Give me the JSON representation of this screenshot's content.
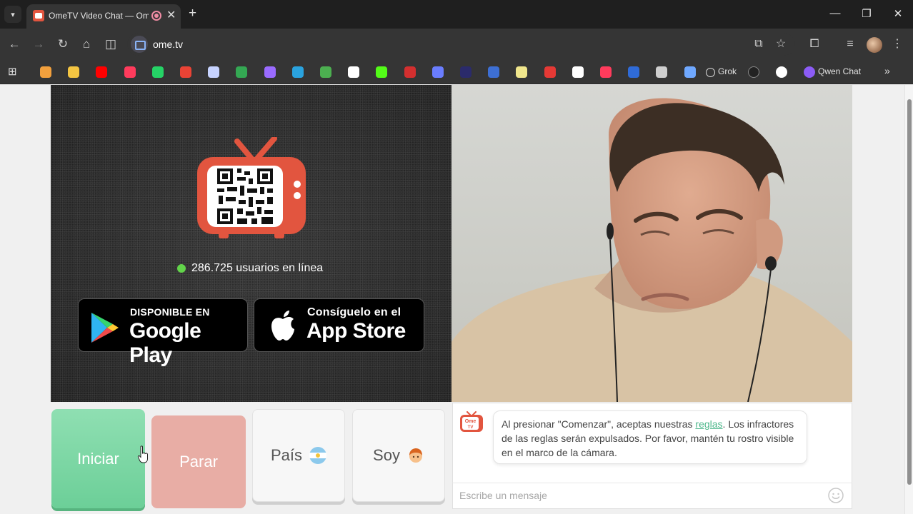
{
  "browser": {
    "tab_title": "OmeTV Video Chat — Ome",
    "url": "ome.tv",
    "bookmarks": [
      {
        "name": "bookmark-in",
        "color": "#f2a03d"
      },
      {
        "name": "bookmark-pencil",
        "color": "#f4c542"
      },
      {
        "name": "bookmark-youtube",
        "color": "#ff0000"
      },
      {
        "name": "bookmark-music",
        "color": "#ff3b5c"
      },
      {
        "name": "bookmark-whatsapp",
        "color": "#25d366"
      },
      {
        "name": "bookmark-gmail",
        "color": "#ea4335"
      },
      {
        "name": "bookmark-cloud",
        "color": "#c7d3ff"
      },
      {
        "name": "bookmark-drive",
        "color": "#34a853"
      },
      {
        "name": "bookmark-rocket",
        "color": "#9a6bff"
      },
      {
        "name": "bookmark-telegram",
        "color": "#2aa3df"
      },
      {
        "name": "bookmark-game",
        "color": "#4caf50"
      },
      {
        "name": "bookmark-tiktok",
        "color": "#ffffff"
      },
      {
        "name": "bookmark-kick",
        "color": "#53fc18"
      },
      {
        "name": "bookmark-324",
        "color": "#d32f2f"
      },
      {
        "name": "bookmark-blue",
        "color": "#6a7dfe"
      },
      {
        "name": "bookmark-p-dark",
        "color": "#2b2b6b"
      },
      {
        "name": "bookmark-ai",
        "color": "#3d6fd4"
      },
      {
        "name": "bookmark-yellow",
        "color": "#f0e68c"
      },
      {
        "name": "bookmark-sp",
        "color": "#e53935"
      },
      {
        "name": "bookmark-c",
        "color": "#ffffff"
      },
      {
        "name": "bookmark-p-red",
        "color": "#ff3b5c"
      },
      {
        "name": "bookmark-paypal",
        "color": "#2f6bd8"
      },
      {
        "name": "bookmark-openai",
        "color": "#cfcfcf"
      },
      {
        "name": "bookmark-gemini",
        "color": "#6fa8ff"
      }
    ],
    "bookmark_grok": "Grok",
    "bookmark_qwen": "Qwen Chat"
  },
  "main": {
    "online_count": "286.725 usuarios en línea",
    "google_play": {
      "small": "DISPONIBLE EN",
      "big": "Google Play"
    },
    "app_store": {
      "small": "Consíguelo en el",
      "big": "App Store"
    }
  },
  "controls": {
    "start": "Iniciar",
    "stop": "Parar",
    "country": "País",
    "me": "Soy"
  },
  "chat": {
    "logo_top": "Ome",
    "logo_bottom": "TV",
    "message_before": "Al presionar \"Comenzar\", aceptas nuestras ",
    "message_link": "reglas",
    "message_after": ". Los infractores de las reglas serán expulsados. Por favor, mantén tu rostro visible en el marco de la cámara.",
    "input_placeholder": "Escribe un mensaje"
  },
  "colors": {
    "start": "#7dd6a4",
    "stop": "#e8ada5",
    "online_dot": "#62d44a",
    "link": "#4db78b",
    "tv": "#e2553f"
  }
}
